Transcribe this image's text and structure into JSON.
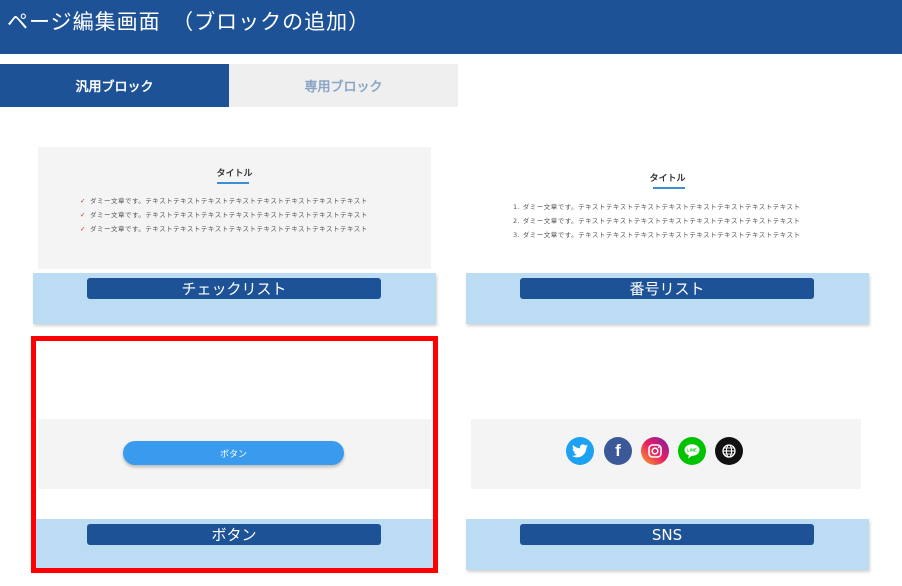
{
  "header": {
    "title": "ページ編集画面　（ブロックの追加）"
  },
  "tabs": [
    {
      "label": "汎用ブロック",
      "active": true
    },
    {
      "label": "専用ブロック",
      "active": false
    }
  ],
  "cards": {
    "checklist": {
      "label": "チェックリスト",
      "preview": {
        "title": "タイトル",
        "items": [
          "ダミー文章です。テキストテキストテキストテキストテキストテキストテキストテキスト",
          "ダミー文章です。テキストテキストテキストテキストテキストテキストテキストテキスト",
          "ダミー文章です。テキストテキストテキストテキストテキストテキストテキストテキスト"
        ]
      }
    },
    "numbered": {
      "label": "番号リスト",
      "preview": {
        "title": "タイトル",
        "items": [
          "1. ダミー文章です。テキストテキストテキストテキストテキストテキストテキストテキスト",
          "2. ダミー文章です。テキストテキストテキストテキストテキストテキストテキストテキスト",
          "3. ダミー文章です。テキストテキストテキストテキストテキストテキストテキストテキスト"
        ]
      }
    },
    "button": {
      "label": "ボタン",
      "preview": {
        "button_label": "ボタン"
      }
    },
    "sns": {
      "label": "SNS",
      "preview": {
        "icons": [
          {
            "name": "twitter-icon",
            "glyph": "🐦",
            "color": "#1da1f2"
          },
          {
            "name": "facebook-icon",
            "glyph": "f",
            "color": "#3b5998"
          },
          {
            "name": "instagram-icon",
            "glyph": "◎",
            "color": "#d6249f"
          },
          {
            "name": "line-icon",
            "glyph": "LINE",
            "color": "#00c300"
          },
          {
            "name": "web-icon",
            "glyph": "⊕",
            "color": "#111111"
          }
        ]
      }
    }
  },
  "colors": {
    "header_bg": "#1d5297",
    "label_area_bg": "#bcdcf3",
    "selection_border": "#ff0000",
    "accent_blue": "#3a9bee"
  }
}
